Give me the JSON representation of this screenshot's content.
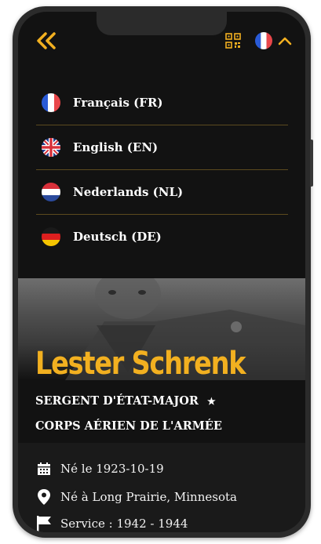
{
  "header": {
    "back_icon": "double-chevron-left-icon",
    "qr_icon": "qr-code-icon",
    "current_language_flag": "flag-fr-icon",
    "collapse_icon": "chevron-up-icon",
    "accent_color": "#f2b020"
  },
  "languages": [
    {
      "label": "Français (FR)",
      "flag": "flag-fr-icon"
    },
    {
      "label": "English (EN)",
      "flag": "flag-uk-icon"
    },
    {
      "label": "Nederlands (NL)",
      "flag": "flag-nl-icon"
    },
    {
      "label": "Deutsch (DE)",
      "flag": "flag-de-icon"
    }
  ],
  "profile": {
    "name": "Lester Schrenk",
    "rank": "SERGENT D'ÉTAT-MAJOR",
    "rank_star": "★",
    "unit": "CORPS AÉRIEN DE L'ARMÉE"
  },
  "details": {
    "born_date": "Né le 1923-10-19",
    "born_place": "Né à Long Prairie, Minnesota",
    "service": "Service : 1942 - 1944"
  }
}
